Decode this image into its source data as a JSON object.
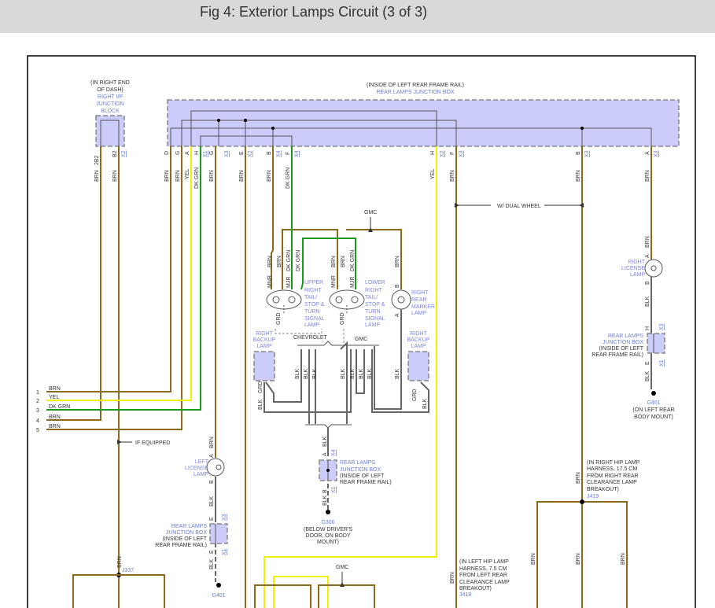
{
  "header": {
    "title": "Fig 4: Exterior Lamps Circuit (3 of 3)"
  },
  "ip_block": {
    "line1": "(IN RIGHT END",
    "line2": "OF DASH)",
    "line3": "RIGHT I/P",
    "line4": "JUNCTION",
    "line5": "BLOCK"
  },
  "rear_box": {
    "line1": "(INSIDE OF LEFT REAR FRAME RAIL)",
    "line2": "REAR LAMPS JUNCTION BOX"
  },
  "pins": [
    {
      "pin": "2B2",
      "conn": "",
      "color": "BRN"
    },
    {
      "pin": "B2",
      "conn": "X2",
      "color": "BRN"
    },
    {
      "pin": "D",
      "conn": "",
      "color": "BRN"
    },
    {
      "pin": "G",
      "conn": "",
      "color": "BRN"
    },
    {
      "pin": "A",
      "conn": "",
      "color": "YEL"
    },
    {
      "pin": "H",
      "conn": "X1",
      "color": "DK GRN"
    },
    {
      "pin": "G",
      "conn": "X3",
      "color": "BRN"
    },
    {
      "pin": "E",
      "conn": "X2",
      "color": "BRN"
    },
    {
      "pin": "B",
      "conn": "X4",
      "color": "BRN"
    },
    {
      "pin": "F",
      "conn": "X4",
      "color": "DK GRN"
    },
    {
      "pin": "H",
      "conn": "X2",
      "color": "YEL"
    },
    {
      "pin": "F",
      "conn": "X3",
      "color": "BRN"
    },
    {
      "pin": "B",
      "conn": "X3",
      "color": "BRN"
    },
    {
      "pin": "A",
      "conn": "X3",
      "color": "BRN"
    }
  ],
  "offpage": [
    {
      "num": "1",
      "color": "BRN"
    },
    {
      "num": "2",
      "color": "YEL"
    },
    {
      "num": "3",
      "color": "DK GRN"
    },
    {
      "num": "4",
      "color": "BRN"
    },
    {
      "num": "5",
      "color": "BRN"
    }
  ],
  "labels": {
    "gmc": "GMC",
    "chevrolet": "CHEVROLET",
    "dual_wheel": "W/ DUAL WHEEL",
    "if_equipped": "IF EQUIPPED",
    "brn": "BRN",
    "dkgrn": "DK GRN",
    "blk": "BLK",
    "grd": "GRD",
    "mnr": "MNR",
    "mjr": "MJR",
    "yel": "YEL",
    "a": "A",
    "b": "B",
    "e": "E",
    "h": "H",
    "x1": "X1",
    "x3": "X3",
    "x4": "X4"
  },
  "lamps": {
    "upper": [
      "UPPER",
      "RIGHT",
      "TAIL/",
      "STOP &",
      "TURN",
      "SIGNAL",
      "LAMP"
    ],
    "lower": [
      "LOWER",
      "RIGHT",
      "TAIL/",
      "STOP &",
      "TURN",
      "SIGNAL",
      "LAMP"
    ],
    "marker": [
      "RIGHT",
      "REAR",
      "MARKER",
      "LAMP"
    ],
    "backup": [
      "RIGHT",
      "BACKUP",
      "LAMP"
    ],
    "left_license": [
      "LEFT",
      "LICENSE",
      "LAMP"
    ],
    "right_license": [
      "RIGHT",
      "LICENSE",
      "LAMP"
    ]
  },
  "junction_small": [
    "REAR LAMPS",
    "JUNCTION BOX",
    "(INSIDE OF LEFT",
    "REAR FRAME RAIL)"
  ],
  "grounds": {
    "g401": "G401",
    "g401_loc": [
      "(ON LEFT REAR",
      "BODY MOUNT)"
    ],
    "g300": "G300",
    "g300_loc": [
      "(BELOW DRIVER'S",
      "DOOR, ON BODY",
      "MOUNT)"
    ]
  },
  "splices": {
    "j337": "J337",
    "j419": [
      "(IN RIGHT HIP LAMP",
      "HARNESS, 17.5 CM",
      "FROM RIGHT REAR",
      "CLEARANCE LAMP",
      "BREAKOUT)",
      "J419"
    ],
    "j418": [
      "(IN LEFT HIP LAMP",
      "HARNESS, 7.5 CM",
      "FROM LEFT REAR",
      "CLEARANCE LAMP",
      "BREAKOUT)",
      "J418"
    ]
  }
}
